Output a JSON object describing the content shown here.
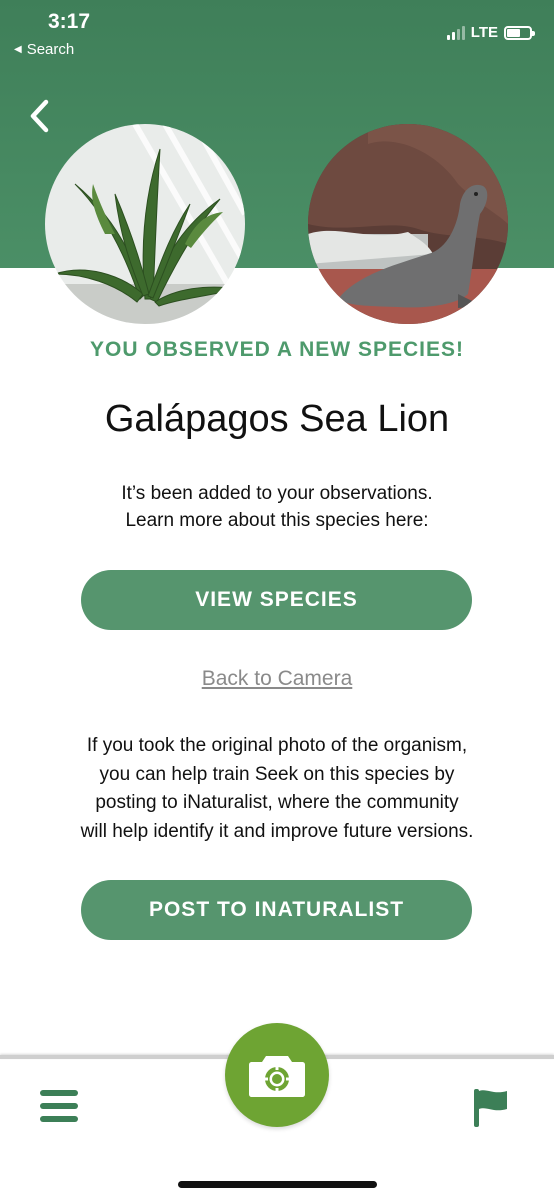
{
  "status_bar": {
    "time": "3:17",
    "back_app": "Search",
    "network": "LTE"
  },
  "header": {
    "back_icon": "chevron-left-icon",
    "photos": [
      {
        "subject": "plant"
      },
      {
        "subject": "sea-lion"
      }
    ],
    "colors": {
      "band": "#4a8c64"
    }
  },
  "main": {
    "heading": "YOU OBSERVED A NEW SPECIES!",
    "species_name": "Galápagos Sea Lion",
    "added_line1": "It’s been added to your observations.",
    "added_line2": "Learn more about this species here:",
    "view_species_label": "VIEW SPECIES",
    "back_to_camera_label": "Back to Camera",
    "train_line1": "If you took the original photo of the organism,",
    "train_line2": "you can help train Seek on this species by",
    "train_line3": "posting to iNaturalist, where the community",
    "train_line4": "will help identify it and improve future versions.",
    "post_label": "POST TO INATURALIST",
    "colors": {
      "accent": "#4e9a6c",
      "button": "#56956e"
    }
  },
  "bottom_nav": {
    "menu_icon": "hamburger-menu-icon",
    "camera_icon": "camera-icon",
    "flag_icon": "flag-icon",
    "colors": {
      "camera_bg": "#6ea433",
      "icon": "#3c7f57"
    }
  }
}
